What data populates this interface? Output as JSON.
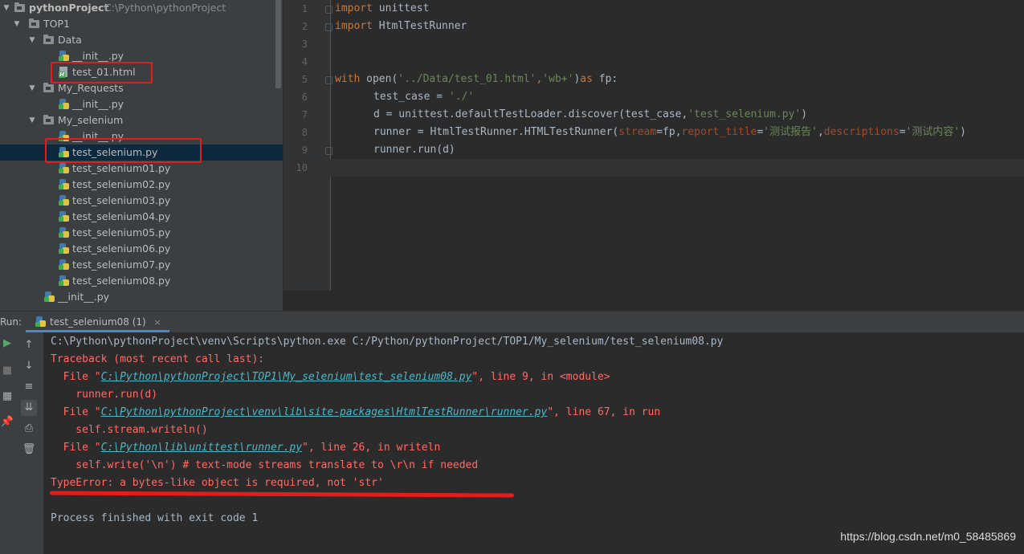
{
  "project": {
    "root_name": "pythonProject",
    "root_path": "C:\\Python\\pythonProject",
    "nodes": [
      {
        "label": "TOP1"
      },
      {
        "label": "Data"
      },
      {
        "label": "__init__.py"
      },
      {
        "label": "test_01.html"
      },
      {
        "label": "My_Requests"
      },
      {
        "label": "__init__.py"
      },
      {
        "label": "My_selenium"
      },
      {
        "label": "__init__.py"
      },
      {
        "label": "test_selenium.py"
      },
      {
        "label": "test_selenium01.py"
      },
      {
        "label": "test_selenium02.py"
      },
      {
        "label": "test_selenium03.py"
      },
      {
        "label": "test_selenium04.py"
      },
      {
        "label": "test_selenium05.py"
      },
      {
        "label": "test_selenium06.py"
      },
      {
        "label": "test_selenium07.py"
      },
      {
        "label": "test_selenium08.py"
      },
      {
        "label": "__init__.py"
      }
    ]
  },
  "editor": {
    "line_numbers": [
      "1",
      "2",
      "3",
      "4",
      "5",
      "6",
      "7",
      "8",
      "9",
      "10"
    ],
    "code": {
      "l1_kw": "import",
      "l1_rest": " unittest",
      "l2_kw": "import",
      "l2_rest": " HtmlTestRunner",
      "l5_kw": "with",
      "l5_a": " open(",
      "l5_s1": "'../Data/test_01.html'",
      "l5_b": ",",
      "l5_s2": "'wb+'",
      "l5_c": ")",
      "l5_kw2": "as",
      "l5_d": " fp:",
      "l6_a": "test_case = ",
      "l6_s": "'./'",
      "l7_a": "d = unittest.defaultTestLoader.discover(test_case,",
      "l7_s": "'test_selenium.py'",
      "l7_b": ")",
      "l8_a": "runner = HtmlTestRunner.HTMLTestRunner(",
      "l8_p1": "stream",
      "l8_b": "=fp,",
      "l8_p2": "report_title",
      "l8_c": "=",
      "l8_s1": "'测试报告'",
      "l8_d": ",",
      "l8_p3": "descriptions",
      "l8_e": "=",
      "l8_s2": "'测试内容'",
      "l8_f": ")",
      "l9_a": "runner.run(d)"
    }
  },
  "run": {
    "label": "Run:",
    "tab_title": "test_selenium08 (1)",
    "tab_close": "×",
    "output": {
      "cmd": "C:\\Python\\pythonProject\\venv\\Scripts\\python.exe C:/Python/pythonProject/TOP1/My_selenium/test_selenium08.py",
      "traceback": "Traceback (most recent call last):",
      "f1_pre": "  File \"",
      "f1_link": "C:\\Python\\pythonProject\\TOP1\\My_selenium\\test_selenium08.py",
      "f1_post": "\", line 9, in <module>",
      "f1_code": "    runner.run(d)",
      "f2_pre": "  File \"",
      "f2_link": "C:\\Python\\pythonProject\\venv\\lib\\site-packages\\HtmlTestRunner\\runner.py",
      "f2_post": "\", line 67, in run",
      "f2_code": "    self.stream.writeln()",
      "f3_pre": "  File \"",
      "f3_link": "C:\\Python\\lib\\unittest\\runner.py",
      "f3_post": "\", line 26, in writeln",
      "f3_code": "    self.write('\\n') # text-mode streams translate to \\r\\n if needed",
      "error": "TypeError: a bytes-like object is required, not 'str'",
      "finished": "Process finished with exit code 1"
    }
  },
  "watermark": "https://blog.csdn.net/m0_58485869",
  "colors": {
    "highlight_box": "#e51c1c",
    "selection": "#0d293e",
    "error_text": "#ff6b68",
    "link_text": "#4cb7c8"
  }
}
